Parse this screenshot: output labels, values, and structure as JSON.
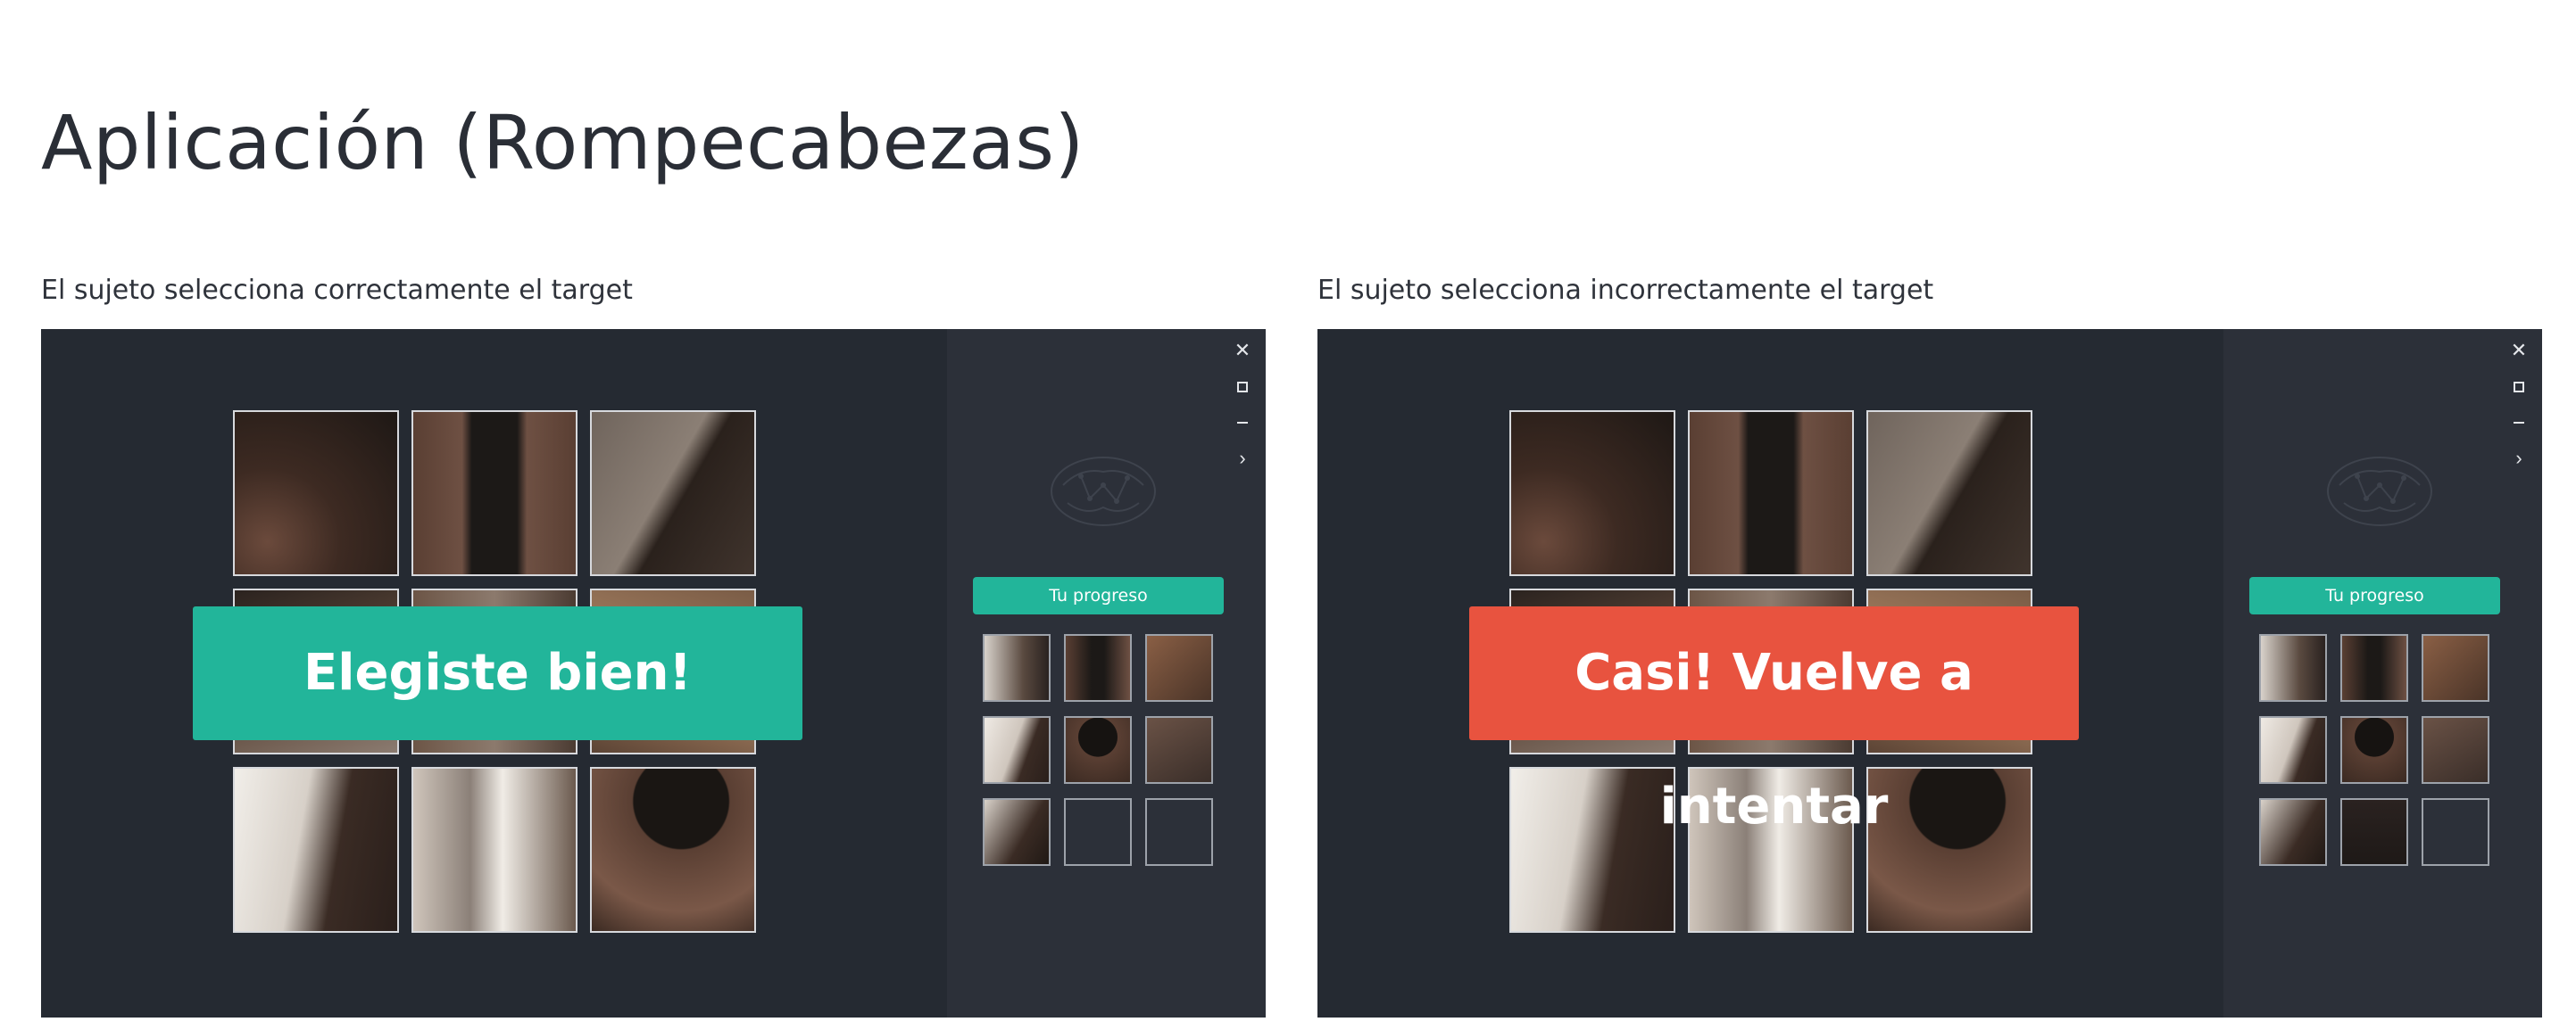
{
  "page": {
    "title": "Aplicación (Rompecabezas)"
  },
  "panels": [
    {
      "caption": "El sujeto selecciona correctamente el target",
      "banner": {
        "text": "Elegiste bien!",
        "color": "#22b59a"
      },
      "sidebar": {
        "progress_label": "Tu progreso",
        "accent": "#22b59a",
        "filled_count": 7,
        "total_count": 9
      },
      "window_controls": [
        "close-icon",
        "maximize-icon",
        "minimize-icon",
        "chevron-right-icon"
      ]
    },
    {
      "caption": "El sujeto selecciona incorrectamente el target",
      "banner": {
        "text": "Casi! Vuelve a intentar",
        "color": "#e8533f"
      },
      "sidebar": {
        "progress_label": "Tu progreso",
        "accent": "#22b59a",
        "filled_count": 8,
        "total_count": 9
      },
      "window_controls": [
        "close-icon",
        "maximize-icon",
        "minimize-icon",
        "chevron-right-icon"
      ]
    }
  ],
  "colors": {
    "panel_bg": "#252a32",
    "sidebar_bg": "#2c3039",
    "tile_border": "#d7d9dd"
  }
}
